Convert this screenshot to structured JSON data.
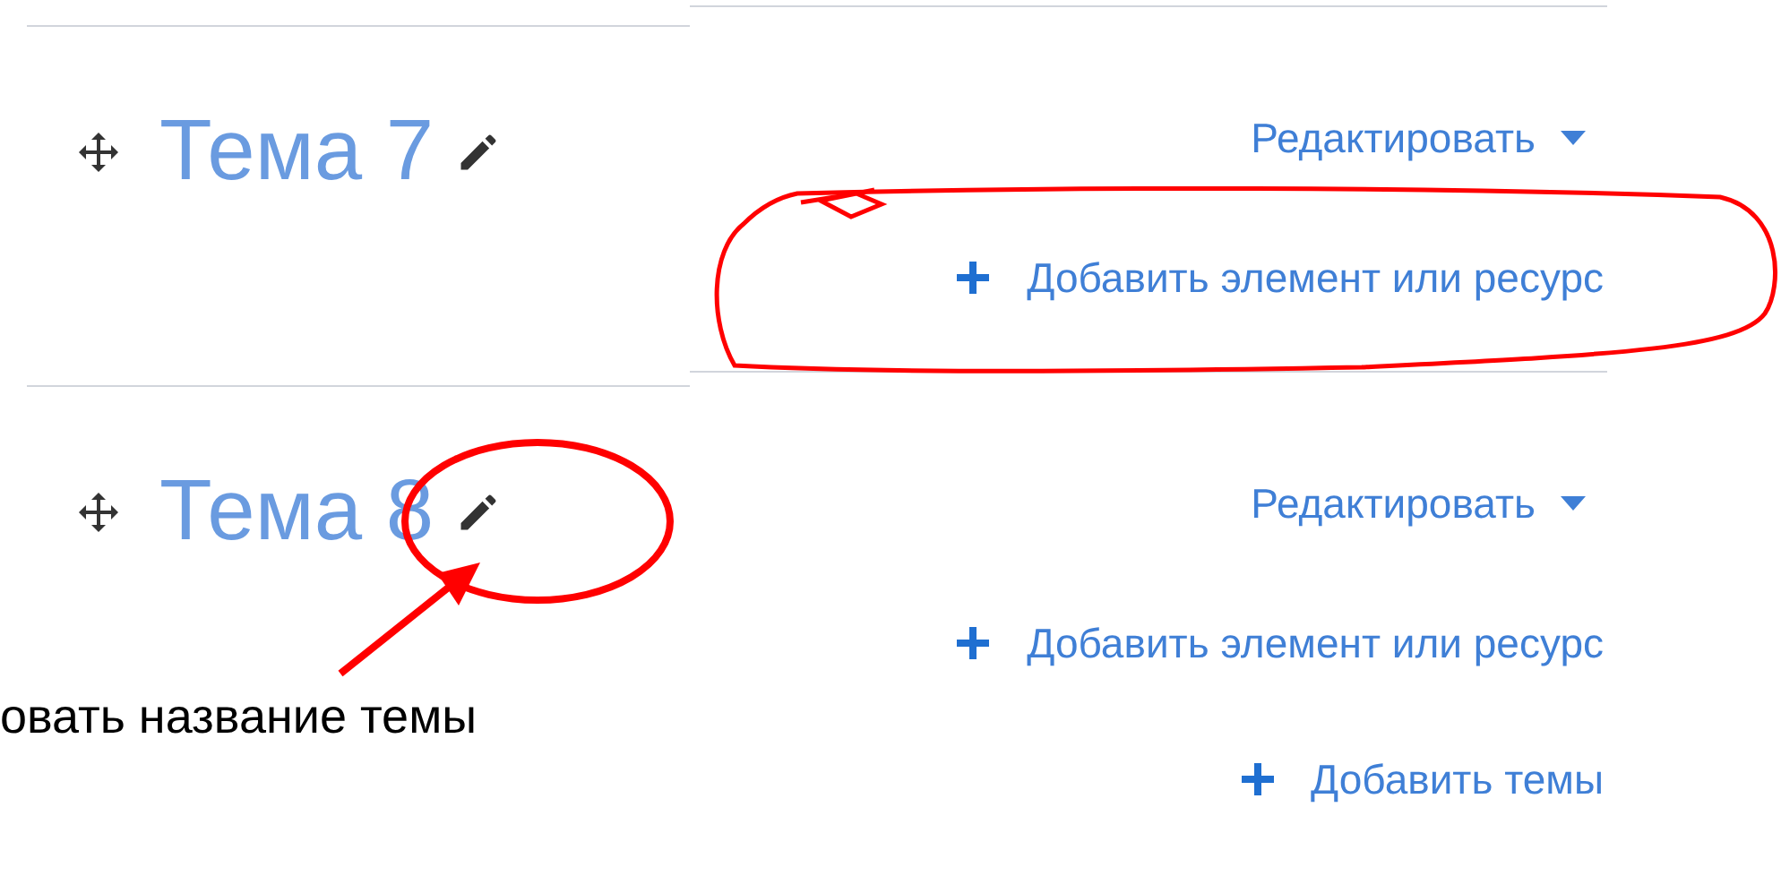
{
  "sections": [
    {
      "title": "Тема 7",
      "edit_menu": "Редактировать",
      "add_activity": "Добавить элемент или ресурс"
    },
    {
      "title": "Тема 8",
      "edit_menu": "Редактировать",
      "add_activity": "Добавить элемент или ресурс"
    }
  ],
  "add_topics": "Добавить темы",
  "annotation": {
    "caption": "овать название темы"
  }
}
